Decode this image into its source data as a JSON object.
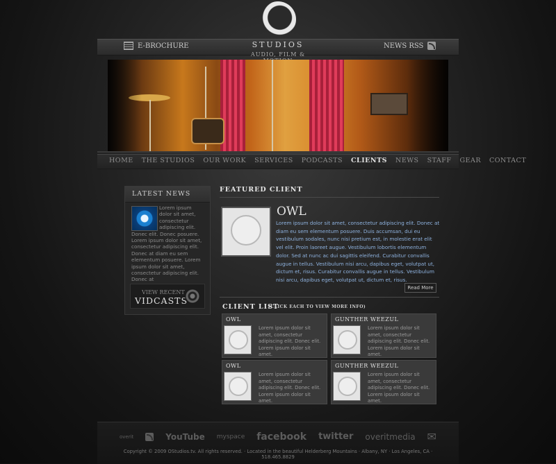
{
  "header": {
    "logo_text": "STUDIOS",
    "logo_subtitle": "AUDIO, FILM & MOTION",
    "ebrochure_label": "E-BROCHURE",
    "news_rss_label": "NEWS RSS"
  },
  "nav": {
    "items": [
      "HOME",
      "THE STUDIOS",
      "OUR WORK",
      "SERVICES",
      "PODCASTS",
      "CLIENTS",
      "NEWS",
      "STAFF",
      "GEAR",
      "CONTACT"
    ],
    "active": "CLIENTS"
  },
  "latest_news": {
    "title": "LATEST NEWS",
    "body": "Lorem ipsum dolor sit amet, consectetur adipiscing elit. Donec elit. Donec posuere. Lorem ipsum dolor sit amet, consectetur adipiscing elit. Donec at diam eu sem elementum posuere. Lorem ipsum dolor sit amet, consectetur adipiscing elit. Donec at",
    "vidcasts_small": "VIEW RECENT",
    "vidcasts_big": "VIDCASTS"
  },
  "featured": {
    "section_title": "FEATURED CLIENT",
    "name": "OWL",
    "description": "Lorem ipsum dolor sit amet, consectetur adipiscing elit. Donec at diam eu sem elementum posuere. Duis accumsan, dui eu vestibulum sodales, nunc nisi pretium est, in molestie erat elit vel elit. Proin laoreet augue. Vestibulum lobortis elementum dolor. Sed at nunc ac dui sagittis eleifend. Curabitur convallis augue in tellus. Vestibulum nisi arcu, dapibus eget, volutpat ut, dictum et, risus. Curabitur convallis augue in tellus. Vestibulum nisi arcu, dapibus eget, volutpat ut, dictum et, risus.",
    "read_more_label": "Read More"
  },
  "client_list": {
    "title": "CLIENT LIST",
    "note": "(CLICK EACH TO VIEW MORE INFO)",
    "clients": [
      {
        "name": "OWL",
        "desc": "Lorem ipsum dolor sit amet, consectetur adipiscing elit. Donec elit. Lorem ipsum dolor sit amet."
      },
      {
        "name": "GUNTHER WEEZUL",
        "desc": "Lorem ipsum dolor sit amet, consectetur adipiscing elit. Donec elit. Lorem ipsum dolor sit amet."
      },
      {
        "name": "OWL",
        "desc": "Lorem ipsum dolor sit amet, consectetur adipiscing elit. Donec elit. Lorem ipsum dolor sit amet."
      },
      {
        "name": "GUNTHER WEEZUL",
        "desc": "Lorem ipsum dolor sit amet, consectetur adipiscing elit. Donec elit. Lorem ipsum dolor sit amet."
      }
    ]
  },
  "footer": {
    "social": [
      "overit",
      "rss",
      "YouTube",
      "myspace",
      "facebook",
      "twitter",
      "overitmedia",
      "email"
    ],
    "copyright": "Copyright © 2009 OStudios.tv. All rights reserved. · Located in the beautiful Helderberg Mountains · Albany, NY · Los Angeles, CA · 518.465.8829"
  }
}
